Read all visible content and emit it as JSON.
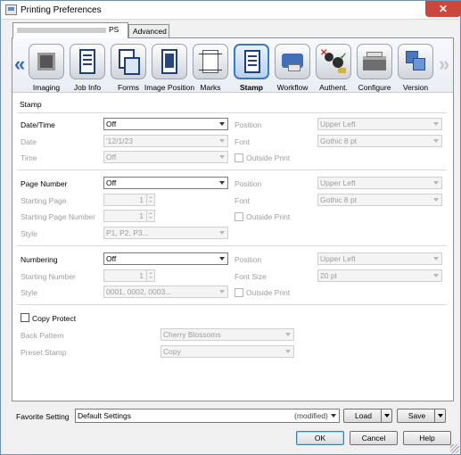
{
  "window": {
    "title": "Printing Preferences",
    "close_glyph": "✕"
  },
  "tabs": [
    {
      "label": "PS",
      "active": true
    },
    {
      "label": "Advanced",
      "active": false
    }
  ],
  "toolbar": {
    "prev_glyph": "«",
    "next_glyph": "»",
    "items": [
      {
        "label": "Imaging",
        "icon": "imaging-icon"
      },
      {
        "label": "Job Info",
        "icon": "job-info-icon"
      },
      {
        "label": "Forms",
        "icon": "forms-icon"
      },
      {
        "label": "Image Position",
        "icon": "image-position-icon"
      },
      {
        "label": "Marks",
        "icon": "marks-icon"
      },
      {
        "label": "Stamp",
        "icon": "stamp-icon",
        "active": true
      },
      {
        "label": "Workflow",
        "icon": "workflow-icon"
      },
      {
        "label": "Authent.",
        "icon": "authentication-icon"
      },
      {
        "label": "Configure",
        "icon": "configure-icon"
      },
      {
        "label": "Version",
        "icon": "version-icon"
      }
    ]
  },
  "stamp": {
    "section_title": "Stamp",
    "datetime": {
      "label": "Date/Time",
      "value": "Off",
      "date_label": "Date",
      "date_value": "'12/1/23",
      "time_label": "Time",
      "time_value": "Off",
      "position_label": "Position",
      "position_value": "Upper Left",
      "font_label": "Font",
      "font_value": "Gothic 8 pt",
      "outside_label": "Outside Print"
    },
    "page_number": {
      "label": "Page Number",
      "value": "Off",
      "starting_page_label": "Starting Page",
      "starting_page_value": "1",
      "starting_page_number_label": "Starting Page Number",
      "starting_page_number_value": "1",
      "style_label": "Style",
      "style_value": "P1, P2, P3...",
      "position_label": "Position",
      "position_value": "Upper Left",
      "font_label": "Font",
      "font_value": "Gothic 8 pt",
      "outside_label": "Outside Print"
    },
    "numbering": {
      "label": "Numbering",
      "value": "Off",
      "starting_number_label": "Starting Number",
      "starting_number_value": "1",
      "style_label": "Style",
      "style_value": "0001, 0002, 0003...",
      "position_label": "Position",
      "position_value": "Upper Left",
      "font_size_label": "Font Size",
      "font_size_value": "20 pt",
      "outside_label": "Outside Print"
    },
    "copy_protect": {
      "label": "Copy Protect",
      "back_pattern_label": "Back Pattern",
      "back_pattern_value": "Cherry Blossoms",
      "preset_stamp_label": "Preset Stamp",
      "preset_stamp_value": "Copy"
    }
  },
  "favorite": {
    "label": "Favorite Setting",
    "value": "Default Settings",
    "modified": "(modified)",
    "load_label": "Load",
    "save_label": "Save"
  },
  "buttons": {
    "ok": "OK",
    "cancel": "Cancel",
    "help": "Help"
  }
}
